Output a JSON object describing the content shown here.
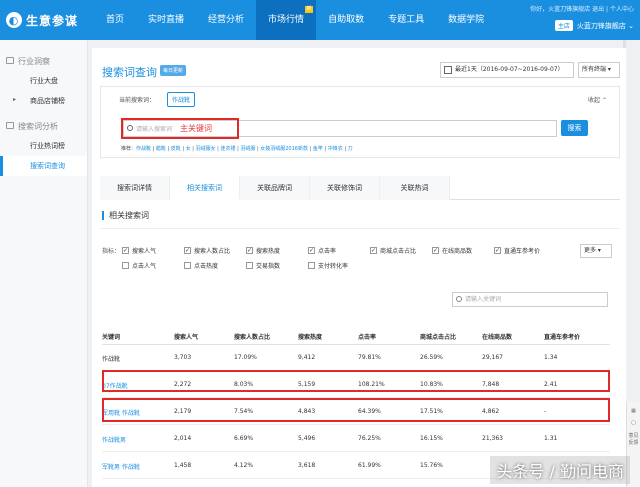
{
  "app": {
    "logo": "生意参谋"
  },
  "nav": [
    {
      "label": "首页"
    },
    {
      "label": "实时直播"
    },
    {
      "label": "经营分析"
    },
    {
      "label": "市场行情",
      "active": true,
      "badge": "新"
    },
    {
      "label": "自助取数"
    },
    {
      "label": "专题工具"
    },
    {
      "label": "数据学院"
    }
  ],
  "user": {
    "greeting": "你好，火蓝刀锋旗舰店",
    "logout": "退出",
    "sep": "|",
    "center": "个人中心",
    "main_tag": "主店",
    "shop": "火蓝刀锋旗舰店"
  },
  "sidebar": [
    {
      "group": "行业洞察",
      "items": [
        {
          "label": "行业大盘"
        },
        {
          "label": "商品店铺榜",
          "arrow": "▸"
        }
      ]
    },
    {
      "group": "搜索词分析",
      "items": [
        {
          "label": "行业热词榜"
        },
        {
          "label": "搜索词查询",
          "active": true
        }
      ]
    }
  ],
  "page": {
    "title": "搜索词查询",
    "tag": "每日更新",
    "date_range": "最近1天（2016-09-07~2016-09-07）",
    "terminal": "所有终端"
  },
  "search": {
    "current_label": "当前搜索词：",
    "current_tag": "作战靴",
    "collapse": "收起",
    "placeholder": "请输入搜索词",
    "keyword_hint": "主关键词",
    "button": "搜索",
    "recommend_label": "推荐：",
    "recommend": [
      "作战靴",
      "蜡靴",
      "皮靴",
      "女",
      "羽绒服女",
      "连衣裙",
      "羽绒服",
      "女装羽绒服2016新款",
      "鱼竿",
      "冲锋衣",
      "刀"
    ]
  },
  "tabs": [
    {
      "label": "搜索词详情"
    },
    {
      "label": "相关搜索词",
      "active": true
    },
    {
      "label": "关联品牌词"
    },
    {
      "label": "关联修饰词"
    },
    {
      "label": "关联热词"
    }
  ],
  "section": {
    "title": "相关搜索词"
  },
  "metrics": {
    "label": "指标：",
    "items": [
      {
        "label": "搜索人气",
        "checked": true
      },
      {
        "label": "搜索人数占比",
        "checked": true
      },
      {
        "label": "搜索热度",
        "checked": true
      },
      {
        "label": "点击率",
        "checked": true
      },
      {
        "label": "商城点击占比",
        "checked": true
      },
      {
        "label": "在线商品数",
        "checked": true
      },
      {
        "label": "直通车参考价",
        "checked": true
      },
      {
        "label": "点击人气",
        "checked": false
      },
      {
        "label": "点击热度",
        "checked": false
      },
      {
        "label": "交易指数",
        "checked": false
      },
      {
        "label": "支付转化率",
        "checked": false
      }
    ],
    "more": "更多"
  },
  "filter": {
    "placeholder": "请输入关键词"
  },
  "table": {
    "headers": [
      "关键词",
      "搜索人气",
      "搜索人数占比",
      "搜索热度",
      "点击率",
      "商城点击占比",
      "在线商品数",
      "直通车参考价"
    ],
    "rows": [
      {
        "kw": "作战靴",
        "blue": false,
        "v": [
          "3,703",
          "17.09%",
          "9,412",
          "79.81%",
          "26.59%",
          "29,167",
          "1.34"
        ]
      },
      {
        "kw": "07作战靴",
        "blue": true,
        "v": [
          "2,272",
          "8.03%",
          "5,159",
          "108.21%",
          "10.83%",
          "7,848",
          "2.41"
        ]
      },
      {
        "kw": "军用靴 作战靴",
        "blue": true,
        "v": [
          "2,179",
          "7.54%",
          "4,843",
          "64.39%",
          "17.51%",
          "4,862",
          "-"
        ]
      },
      {
        "kw": "作战靴男",
        "blue": true,
        "v": [
          "2,014",
          "6.69%",
          "5,496",
          "76.25%",
          "16.15%",
          "21,363",
          "1.31"
        ]
      },
      {
        "kw": "军靴男 作战靴",
        "blue": true,
        "v": [
          "1,458",
          "4.12%",
          "3,618",
          "61.99%",
          "15.76%",
          "",
          ""
        ]
      }
    ]
  },
  "tools": {
    "t1": "意见反馈"
  },
  "watermark": "头条号 / 勤问电商",
  "colors": {
    "primary": "#1a8fe0",
    "highlight": "#e02a2a"
  }
}
